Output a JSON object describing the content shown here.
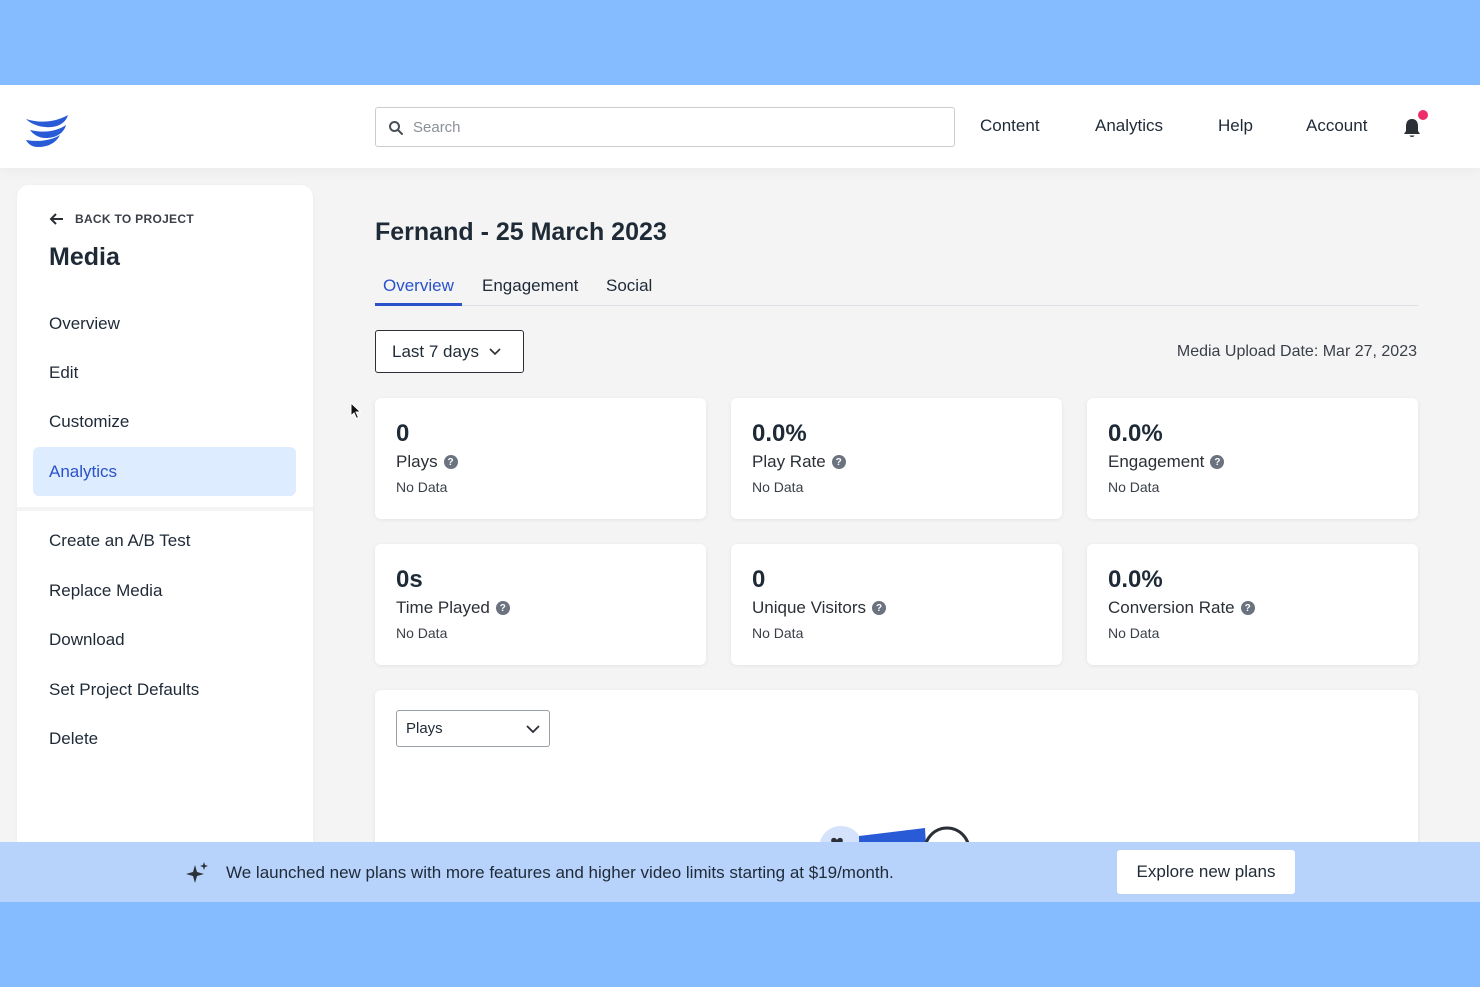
{
  "nav": {
    "search_placeholder": "Search",
    "links": [
      "Content",
      "Analytics",
      "Help",
      "Account"
    ],
    "notification_dot_color": "#ee2d6a",
    "brand_color": "#2a5bd7"
  },
  "sidebar": {
    "back_label": "BACK TO PROJECT",
    "title": "Media",
    "items": [
      {
        "label": "Overview"
      },
      {
        "label": "Edit"
      },
      {
        "label": "Customize"
      },
      {
        "label": "Analytics"
      },
      {
        "label": "Create an A/B Test"
      },
      {
        "label": "Replace Media"
      },
      {
        "label": "Download"
      },
      {
        "label": "Set Project Defaults"
      },
      {
        "label": "Delete"
      }
    ],
    "active_index": 3
  },
  "main": {
    "title": "Fernand - 25 March 2023",
    "tabs": [
      "Overview",
      "Engagement",
      "Social"
    ],
    "active_tab": 0,
    "date_range": "Last 7 days",
    "upload_date": "Media Upload Date: Mar 27, 2023",
    "stats": [
      {
        "value": "0",
        "label": "Plays",
        "sub": "No Data"
      },
      {
        "value": "0.0%",
        "label": "Play Rate",
        "sub": "No Data"
      },
      {
        "value": "0.0%",
        "label": "Engagement",
        "sub": "No Data"
      },
      {
        "value": "0s",
        "label": "Time Played",
        "sub": "No Data"
      },
      {
        "value": "0",
        "label": "Unique Visitors",
        "sub": "No Data"
      },
      {
        "value": "0.0%",
        "label": "Conversion Rate",
        "sub": "No Data"
      }
    ],
    "metric_select": "Plays"
  },
  "banner": {
    "text": "We launched new plans with more features and higher video limits starting at $19/month.",
    "button": "Explore new plans"
  }
}
